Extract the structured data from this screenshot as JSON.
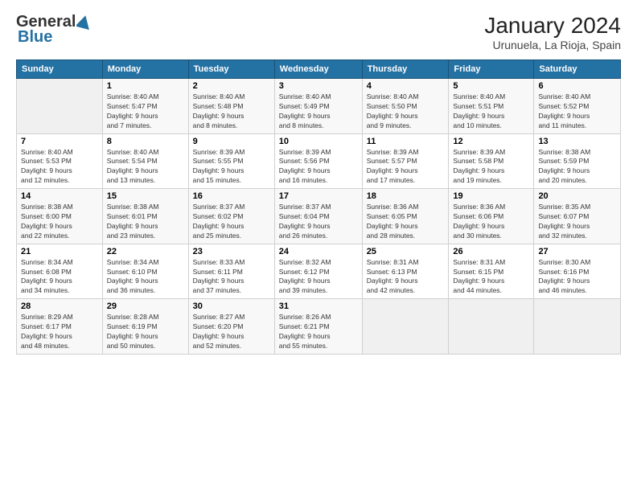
{
  "header": {
    "logo_general": "General",
    "logo_blue": "Blue",
    "title": "January 2024",
    "subtitle": "Urunuela, La Rioja, Spain"
  },
  "days_header": [
    "Sunday",
    "Monday",
    "Tuesday",
    "Wednesday",
    "Thursday",
    "Friday",
    "Saturday"
  ],
  "weeks": [
    [
      {
        "num": "",
        "sunrise": "",
        "sunset": "",
        "daylight": ""
      },
      {
        "num": "1",
        "sunrise": "Sunrise: 8:40 AM",
        "sunset": "Sunset: 5:47 PM",
        "daylight": "Daylight: 9 hours and 7 minutes."
      },
      {
        "num": "2",
        "sunrise": "Sunrise: 8:40 AM",
        "sunset": "Sunset: 5:48 PM",
        "daylight": "Daylight: 9 hours and 8 minutes."
      },
      {
        "num": "3",
        "sunrise": "Sunrise: 8:40 AM",
        "sunset": "Sunset: 5:49 PM",
        "daylight": "Daylight: 9 hours and 8 minutes."
      },
      {
        "num": "4",
        "sunrise": "Sunrise: 8:40 AM",
        "sunset": "Sunset: 5:50 PM",
        "daylight": "Daylight: 9 hours and 9 minutes."
      },
      {
        "num": "5",
        "sunrise": "Sunrise: 8:40 AM",
        "sunset": "Sunset: 5:51 PM",
        "daylight": "Daylight: 9 hours and 10 minutes."
      },
      {
        "num": "6",
        "sunrise": "Sunrise: 8:40 AM",
        "sunset": "Sunset: 5:52 PM",
        "daylight": "Daylight: 9 hours and 11 minutes."
      }
    ],
    [
      {
        "num": "7",
        "sunrise": "Sunrise: 8:40 AM",
        "sunset": "Sunset: 5:53 PM",
        "daylight": "Daylight: 9 hours and 12 minutes."
      },
      {
        "num": "8",
        "sunrise": "Sunrise: 8:40 AM",
        "sunset": "Sunset: 5:54 PM",
        "daylight": "Daylight: 9 hours and 13 minutes."
      },
      {
        "num": "9",
        "sunrise": "Sunrise: 8:39 AM",
        "sunset": "Sunset: 5:55 PM",
        "daylight": "Daylight: 9 hours and 15 minutes."
      },
      {
        "num": "10",
        "sunrise": "Sunrise: 8:39 AM",
        "sunset": "Sunset: 5:56 PM",
        "daylight": "Daylight: 9 hours and 16 minutes."
      },
      {
        "num": "11",
        "sunrise": "Sunrise: 8:39 AM",
        "sunset": "Sunset: 5:57 PM",
        "daylight": "Daylight: 9 hours and 17 minutes."
      },
      {
        "num": "12",
        "sunrise": "Sunrise: 8:39 AM",
        "sunset": "Sunset: 5:58 PM",
        "daylight": "Daylight: 9 hours and 19 minutes."
      },
      {
        "num": "13",
        "sunrise": "Sunrise: 8:38 AM",
        "sunset": "Sunset: 5:59 PM",
        "daylight": "Daylight: 9 hours and 20 minutes."
      }
    ],
    [
      {
        "num": "14",
        "sunrise": "Sunrise: 8:38 AM",
        "sunset": "Sunset: 6:00 PM",
        "daylight": "Daylight: 9 hours and 22 minutes."
      },
      {
        "num": "15",
        "sunrise": "Sunrise: 8:38 AM",
        "sunset": "Sunset: 6:01 PM",
        "daylight": "Daylight: 9 hours and 23 minutes."
      },
      {
        "num": "16",
        "sunrise": "Sunrise: 8:37 AM",
        "sunset": "Sunset: 6:02 PM",
        "daylight": "Daylight: 9 hours and 25 minutes."
      },
      {
        "num": "17",
        "sunrise": "Sunrise: 8:37 AM",
        "sunset": "Sunset: 6:04 PM",
        "daylight": "Daylight: 9 hours and 26 minutes."
      },
      {
        "num": "18",
        "sunrise": "Sunrise: 8:36 AM",
        "sunset": "Sunset: 6:05 PM",
        "daylight": "Daylight: 9 hours and 28 minutes."
      },
      {
        "num": "19",
        "sunrise": "Sunrise: 8:36 AM",
        "sunset": "Sunset: 6:06 PM",
        "daylight": "Daylight: 9 hours and 30 minutes."
      },
      {
        "num": "20",
        "sunrise": "Sunrise: 8:35 AM",
        "sunset": "Sunset: 6:07 PM",
        "daylight": "Daylight: 9 hours and 32 minutes."
      }
    ],
    [
      {
        "num": "21",
        "sunrise": "Sunrise: 8:34 AM",
        "sunset": "Sunset: 6:08 PM",
        "daylight": "Daylight: 9 hours and 34 minutes."
      },
      {
        "num": "22",
        "sunrise": "Sunrise: 8:34 AM",
        "sunset": "Sunset: 6:10 PM",
        "daylight": "Daylight: 9 hours and 36 minutes."
      },
      {
        "num": "23",
        "sunrise": "Sunrise: 8:33 AM",
        "sunset": "Sunset: 6:11 PM",
        "daylight": "Daylight: 9 hours and 37 minutes."
      },
      {
        "num": "24",
        "sunrise": "Sunrise: 8:32 AM",
        "sunset": "Sunset: 6:12 PM",
        "daylight": "Daylight: 9 hours and 39 minutes."
      },
      {
        "num": "25",
        "sunrise": "Sunrise: 8:31 AM",
        "sunset": "Sunset: 6:13 PM",
        "daylight": "Daylight: 9 hours and 42 minutes."
      },
      {
        "num": "26",
        "sunrise": "Sunrise: 8:31 AM",
        "sunset": "Sunset: 6:15 PM",
        "daylight": "Daylight: 9 hours and 44 minutes."
      },
      {
        "num": "27",
        "sunrise": "Sunrise: 8:30 AM",
        "sunset": "Sunset: 6:16 PM",
        "daylight": "Daylight: 9 hours and 46 minutes."
      }
    ],
    [
      {
        "num": "28",
        "sunrise": "Sunrise: 8:29 AM",
        "sunset": "Sunset: 6:17 PM",
        "daylight": "Daylight: 9 hours and 48 minutes."
      },
      {
        "num": "29",
        "sunrise": "Sunrise: 8:28 AM",
        "sunset": "Sunset: 6:19 PM",
        "daylight": "Daylight: 9 hours and 50 minutes."
      },
      {
        "num": "30",
        "sunrise": "Sunrise: 8:27 AM",
        "sunset": "Sunset: 6:20 PM",
        "daylight": "Daylight: 9 hours and 52 minutes."
      },
      {
        "num": "31",
        "sunrise": "Sunrise: 8:26 AM",
        "sunset": "Sunset: 6:21 PM",
        "daylight": "Daylight: 9 hours and 55 minutes."
      },
      {
        "num": "",
        "sunrise": "",
        "sunset": "",
        "daylight": ""
      },
      {
        "num": "",
        "sunrise": "",
        "sunset": "",
        "daylight": ""
      },
      {
        "num": "",
        "sunrise": "",
        "sunset": "",
        "daylight": ""
      }
    ]
  ]
}
